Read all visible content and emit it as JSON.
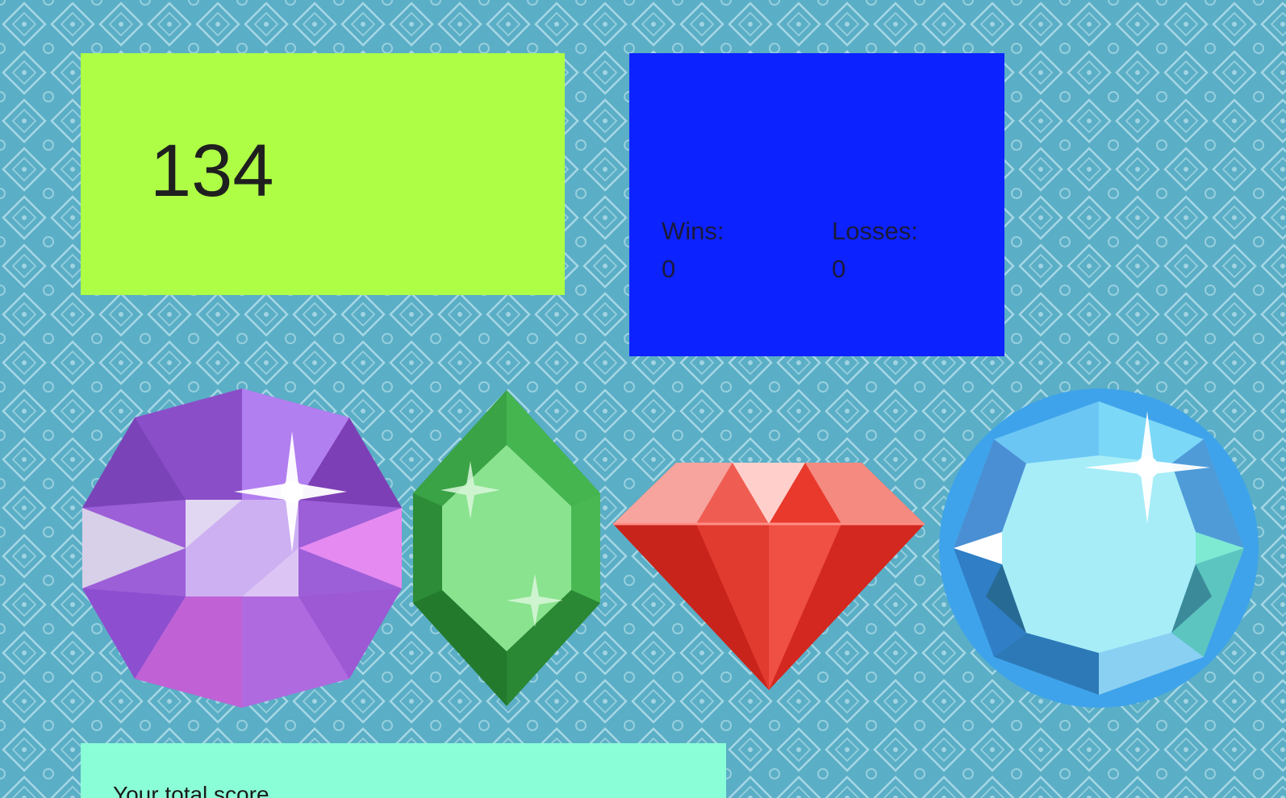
{
  "target": {
    "number": "134"
  },
  "record": {
    "wins_label": "Wins:",
    "wins_value": "0",
    "losses_label": "Losses:",
    "losses_value": "0"
  },
  "gems": [
    "purple-gem",
    "green-gem",
    "red-gem",
    "blue-gem"
  ],
  "score": {
    "label": "Your total score"
  },
  "colors": {
    "background": "#5aaec6",
    "target_box": "#adfe45",
    "record_box": "#0c22ff",
    "score_box": "#8afed7"
  }
}
